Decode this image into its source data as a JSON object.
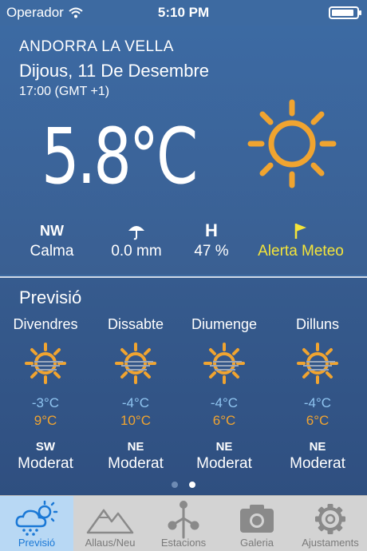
{
  "status_bar": {
    "carrier": "Operador",
    "time": "5:10 PM",
    "battery_level": 0.9
  },
  "current": {
    "city": "ANDORRA LA VELLA",
    "date": "Dijous, 11 De Desembre",
    "hour": "17:00 (GMT +1)",
    "temperature": "5.8°C",
    "condition_icon": "sun-icon",
    "wind_direction": "NW",
    "wind_label": "Calma",
    "rain_icon": "umbrella-icon",
    "rain": "0.0 mm",
    "humidity_head": "H",
    "humidity": "47 %",
    "alert_icon": "flag-icon",
    "alert": "Alerta Meteo"
  },
  "forecast": {
    "title": "Previsió",
    "days": [
      {
        "name": "Divendres",
        "min": "-3°C",
        "max": "9°C",
        "dir": "SW",
        "wind": "Moderat"
      },
      {
        "name": "Dissabte",
        "min": "-4°C",
        "max": "10°C",
        "dir": "NE",
        "wind": "Moderat"
      },
      {
        "name": "Diumenge",
        "min": "-4°C",
        "max": "6°C",
        "dir": "NE",
        "wind": "Moderat"
      },
      {
        "name": "Dilluns",
        "min": "-4°C",
        "max": "6°C",
        "dir": "NE",
        "wind": "Moderat"
      }
    ],
    "page_count": 2,
    "active_page": 2
  },
  "tabs": [
    {
      "label": "Previsió",
      "icon": "cloud-sun-rain-icon",
      "active": true
    },
    {
      "label": "Allaus/Neu",
      "icon": "mountain-icon",
      "active": false
    },
    {
      "label": "Estacions",
      "icon": "weather-station-icon",
      "active": false
    },
    {
      "label": "Galeria",
      "icon": "camera-icon",
      "active": false
    },
    {
      "label": "Ajustaments",
      "icon": "gear-icon",
      "active": false
    }
  ],
  "colors": {
    "background": "#3d6aa1",
    "sun": "#f0a430",
    "min_temp": "#8fc4f0",
    "alert": "#f4e43a",
    "tab_active": "#1a78d6"
  }
}
